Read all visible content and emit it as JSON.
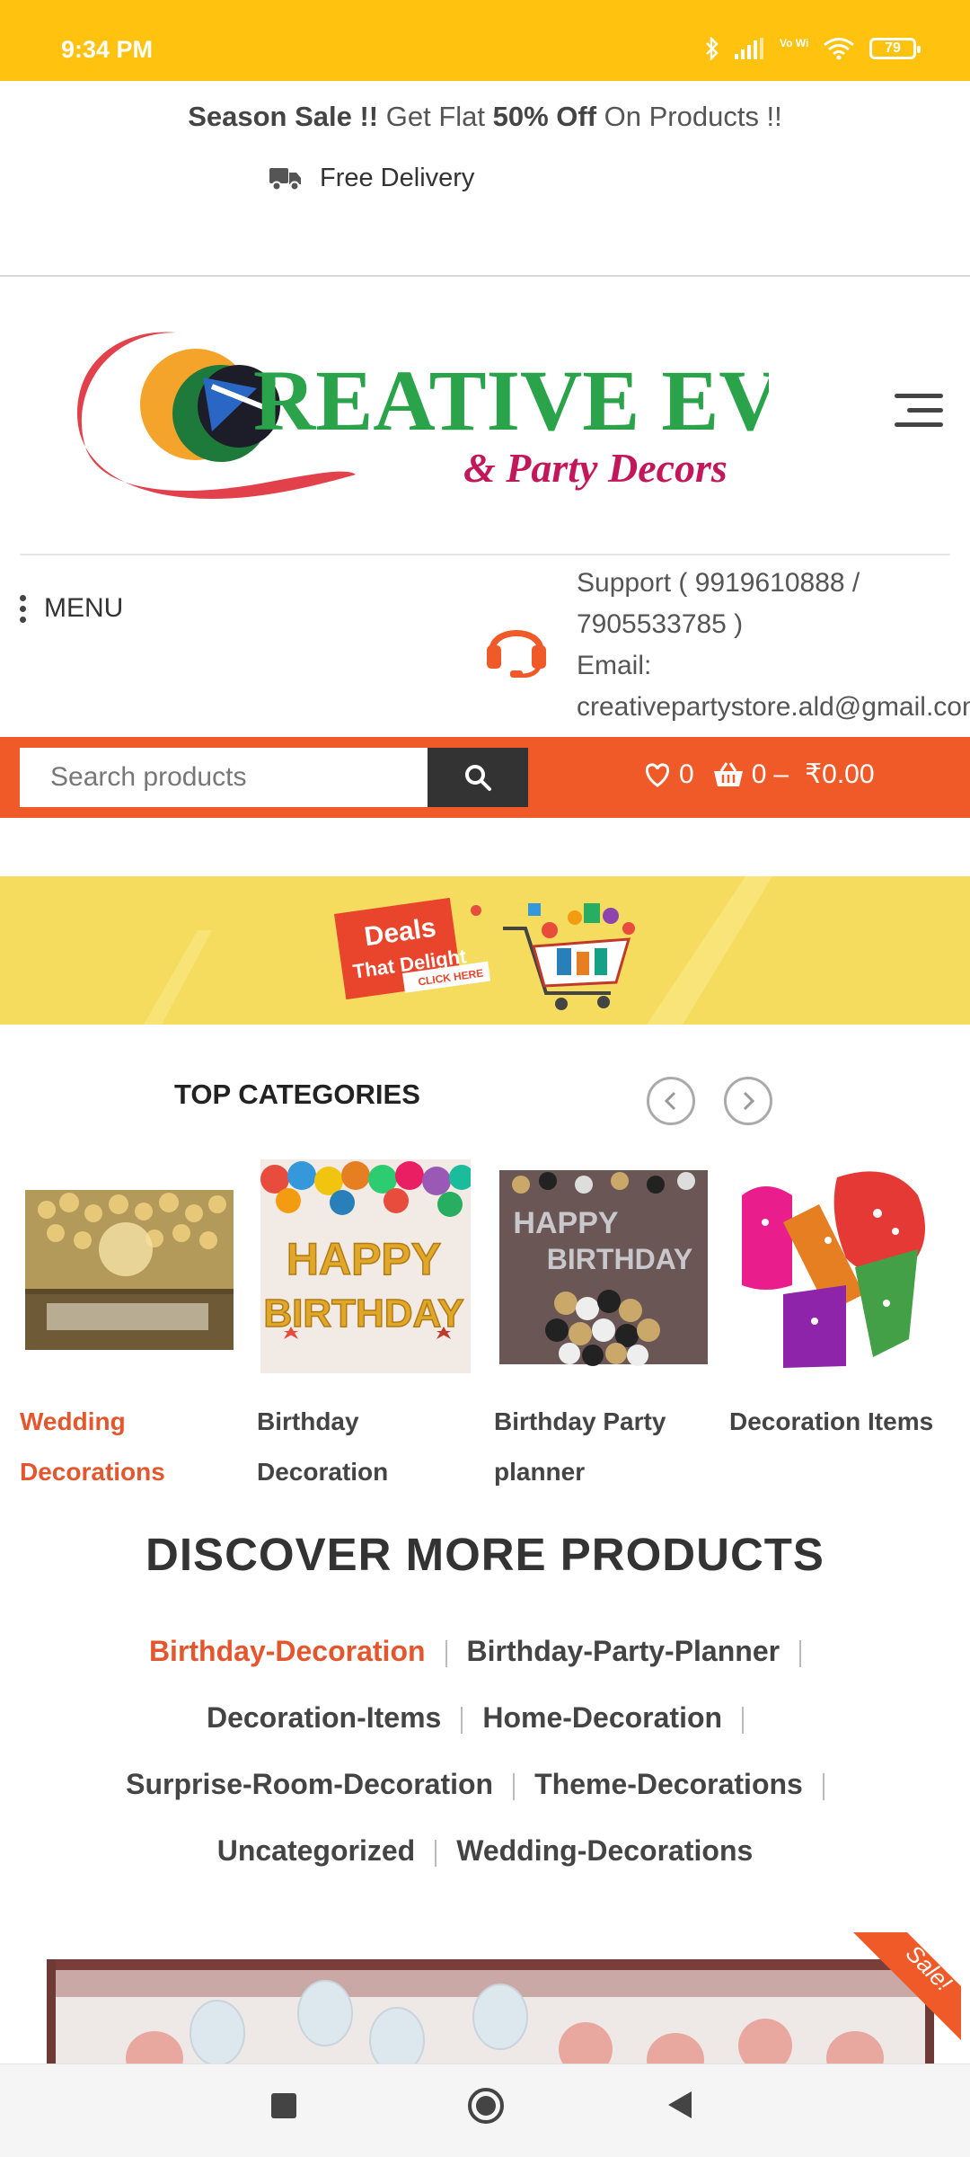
{
  "status_bar": {
    "time": "9:34 PM",
    "battery": "79",
    "vo_wifi": "Vo WiFi"
  },
  "promo": {
    "sale_bold": "Season Sale !!",
    "sale_mid": " Get Flat ",
    "sale_percent": "50% Off",
    "sale_end": " On Products !!",
    "delivery": "Free Delivery"
  },
  "header": {
    "logo_text": "REATIVE EVENTS",
    "logo_sub": "& Party Decors"
  },
  "menu": {
    "label": "MENU"
  },
  "support": {
    "line1": "Support ( 9919610888 /",
    "line2": "7905533785 )",
    "line3": "Email:",
    "line4": "creativepartystore.ald@gmail.com"
  },
  "search": {
    "placeholder": "Search products"
  },
  "cart": {
    "wishlist_count": "0",
    "cart_count": "0",
    "separator": "–",
    "total": "₹0.00"
  },
  "banner": {
    "deals": "Deals",
    "that_delight": "That Delight",
    "click_here": "CLICK HERE"
  },
  "top_categories": {
    "title": "TOP CATEGORIES",
    "items": [
      {
        "label_1": "Wedding",
        "label_2": "Decorations"
      },
      {
        "label_1": "Birthday",
        "label_2": "Decoration"
      },
      {
        "label_1": "Birthday Party",
        "label_2": "planner"
      },
      {
        "label_1": "Decoration Items",
        "label_2": ""
      }
    ],
    "card_2_text_1": "HAPPY",
    "card_2_text_2": "BIRTHDAY",
    "card_3_text_1": "HAPPY",
    "card_3_text_2": "BIRTHDAY"
  },
  "discover": {
    "title": "DISCOVER MORE PRODUCTS",
    "tags": [
      "Birthday-Decoration",
      "Birthday-Party-Planner",
      "Decoration-Items",
      "Home-Decoration",
      "Surprise-Room-Decoration",
      "Theme-Decorations",
      "Uncategorized",
      "Wedding-Decorations"
    ]
  },
  "product": {
    "sale_badge": "Sale!"
  },
  "colors": {
    "status_bar": "#FFC20E",
    "accent": "#F05A28",
    "active_text": "#E4572E",
    "banner": "#F5DC5E"
  }
}
